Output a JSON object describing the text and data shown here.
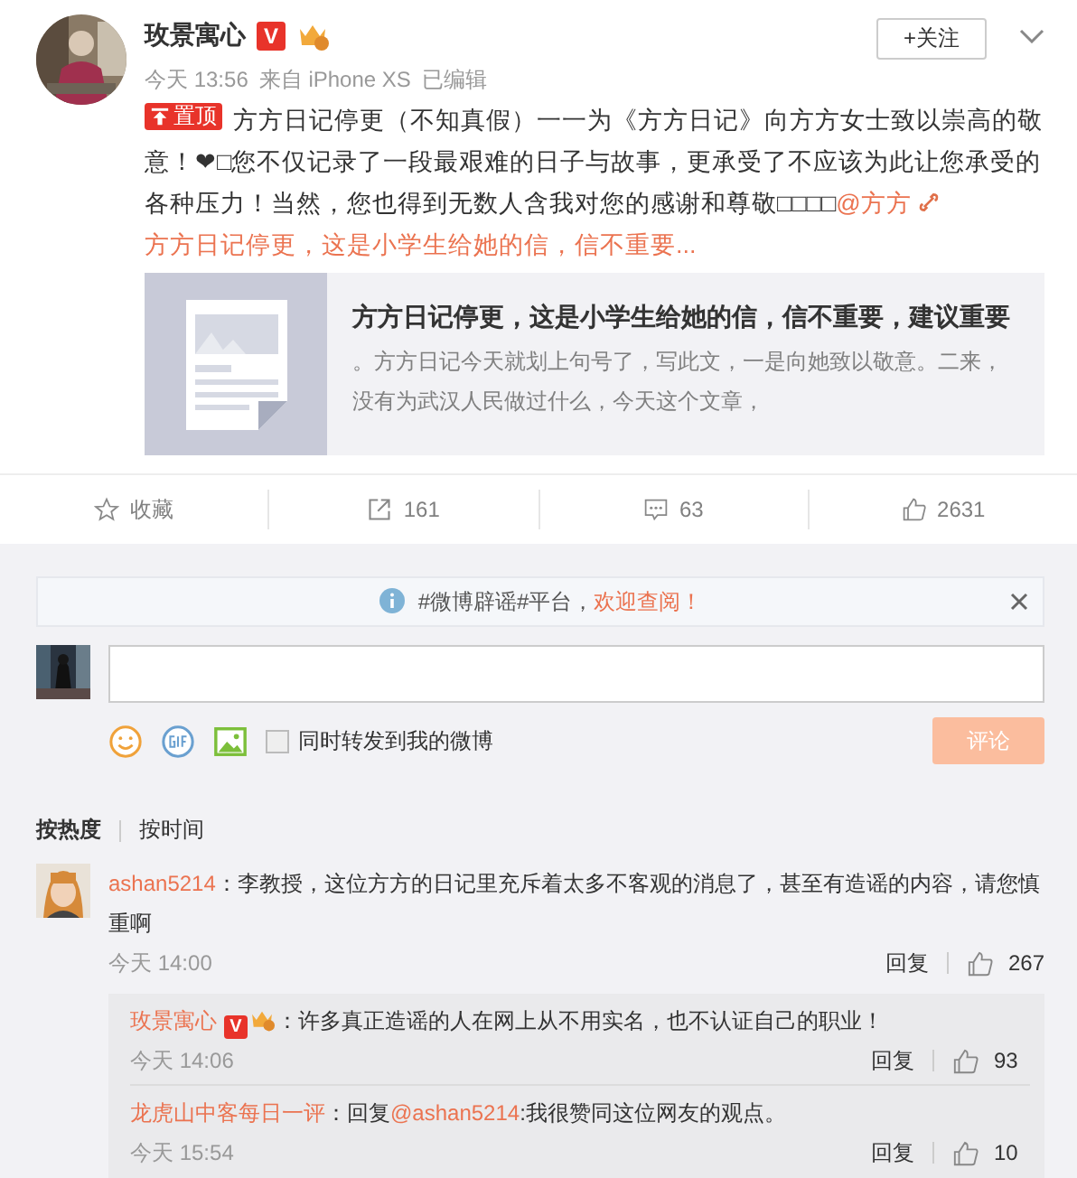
{
  "post": {
    "author": "玫景寓心",
    "verified_badge": "V",
    "follow_button": "+关注",
    "time": "今天 13:56",
    "source": "来自 iPhone XS",
    "edited": "已编辑",
    "pinned_label": "置顶",
    "text": "方方日记停更（不知真假）一一为《方方日记》向方方女士致以崇高的敬意！❤□您不仅记录了一段最艰难的日子与故事，更承受了不应该为此让您承受的各种压力！当然，您也得到无数人含我对您的感谢和尊敬□□□□",
    "mention": "@方方",
    "link_text": "方方日记停更，这是小学生给她的信，信不重要...",
    "card": {
      "title": "方方日记停更，这是小学生给她的信，信不重要，建议重要",
      "summary": "。方方日记今天就划上句号了，写此文，一是向她致以敬意。二来，没有为武汉人民做过什么，今天这个文章，"
    }
  },
  "actions": [
    {
      "kind": "favorite",
      "label": "收藏"
    },
    {
      "kind": "repost",
      "label": "161"
    },
    {
      "kind": "comment",
      "label": "63"
    },
    {
      "kind": "like",
      "label": "2631"
    }
  ],
  "notice": {
    "text": "#微博辟谣#平台，",
    "link": "欢迎查阅！"
  },
  "composer": {
    "sync_label": "同时转发到我的微博",
    "sync_checked": false,
    "submit": "评论"
  },
  "sort_tabs": [
    {
      "label": "按热度",
      "selected": true
    },
    {
      "label": "按时间",
      "selected": false
    }
  ],
  "comments": [
    {
      "user": "ashan5214",
      "text": "：李教授，这位方方的日记里充斥着太多不客观的消息了，甚至有造谣的内容，请您慎重啊",
      "time": "今天 14:00",
      "reply": "回复",
      "likes": "267",
      "replies": [
        {
          "user": "玫景寓心",
          "verified_badge": "V",
          "text": "：许多真正造谣的人在网上从不用实名，也不认证自己的职业！",
          "time": "今天 14:06",
          "reply": "回复",
          "likes": "93"
        },
        {
          "user": "龙虎山中客每日一评",
          "prefix": "：回复",
          "mention": "@ashan5214",
          "text": ":我很赞同这位网友的观点。",
          "time": "今天 15:54",
          "reply": "回复",
          "likes": "10"
        }
      ]
    }
  ]
}
